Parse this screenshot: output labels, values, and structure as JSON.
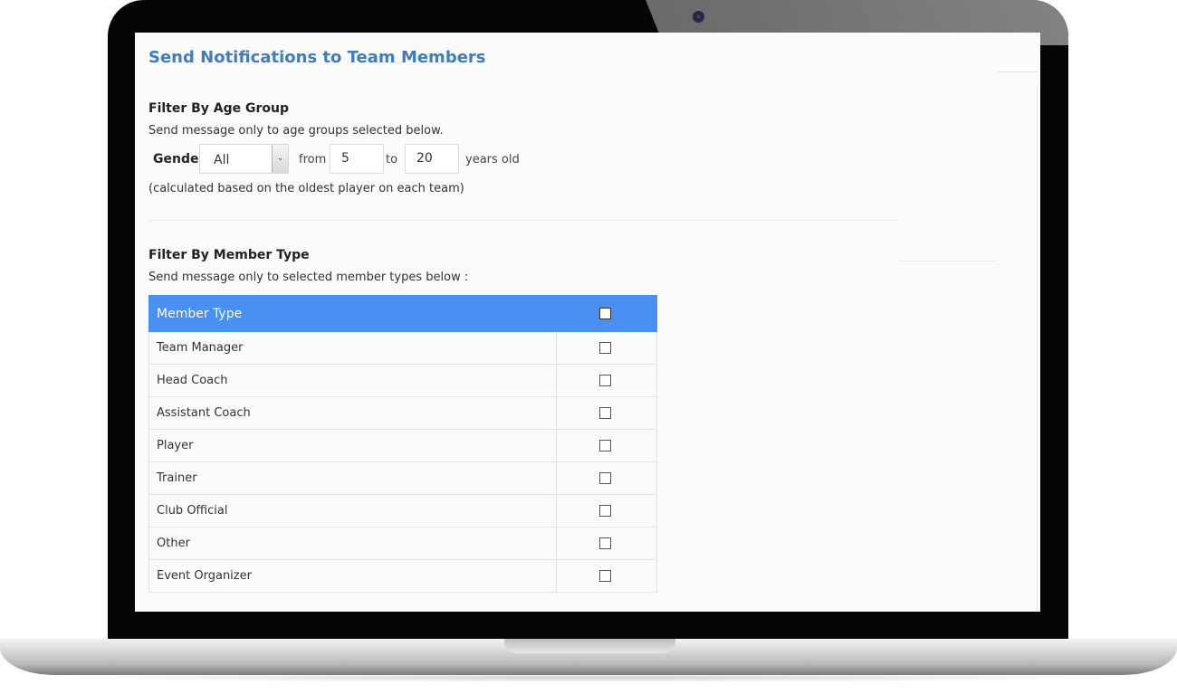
{
  "page": {
    "title": "Send Notifications to Team Members"
  },
  "age_filter": {
    "heading": "Filter By Age Group",
    "description": "Send message only to age groups selected below.",
    "gender_label": "Gender",
    "gender_value": "All",
    "from_label": "from",
    "from_value": "5",
    "to_label": "to",
    "to_value": "20",
    "suffix": "years old",
    "note": "(calculated based on the oldest player on each team)"
  },
  "member_filter": {
    "heading": "Filter By Member Type",
    "description": "Send message only to selected member types below :",
    "table": {
      "header_label": "Member Type",
      "header_checked": false,
      "header_color": "#4a8ff2",
      "rows": [
        {
          "label": "Team Manager",
          "checked": false
        },
        {
          "label": "Head Coach",
          "checked": false
        },
        {
          "label": "Assistant Coach",
          "checked": false
        },
        {
          "label": "Player",
          "checked": false
        },
        {
          "label": "Trainer",
          "checked": false
        },
        {
          "label": "Club Official",
          "checked": false
        },
        {
          "label": "Other",
          "checked": false
        },
        {
          "label": "Event Organizer",
          "checked": false
        }
      ]
    }
  },
  "colors": {
    "title": "#3f7dbf",
    "accent": "#4a8ff2"
  },
  "icons": {
    "select_arrow": "chevron-down-icon",
    "camera": "webcam-icon"
  }
}
